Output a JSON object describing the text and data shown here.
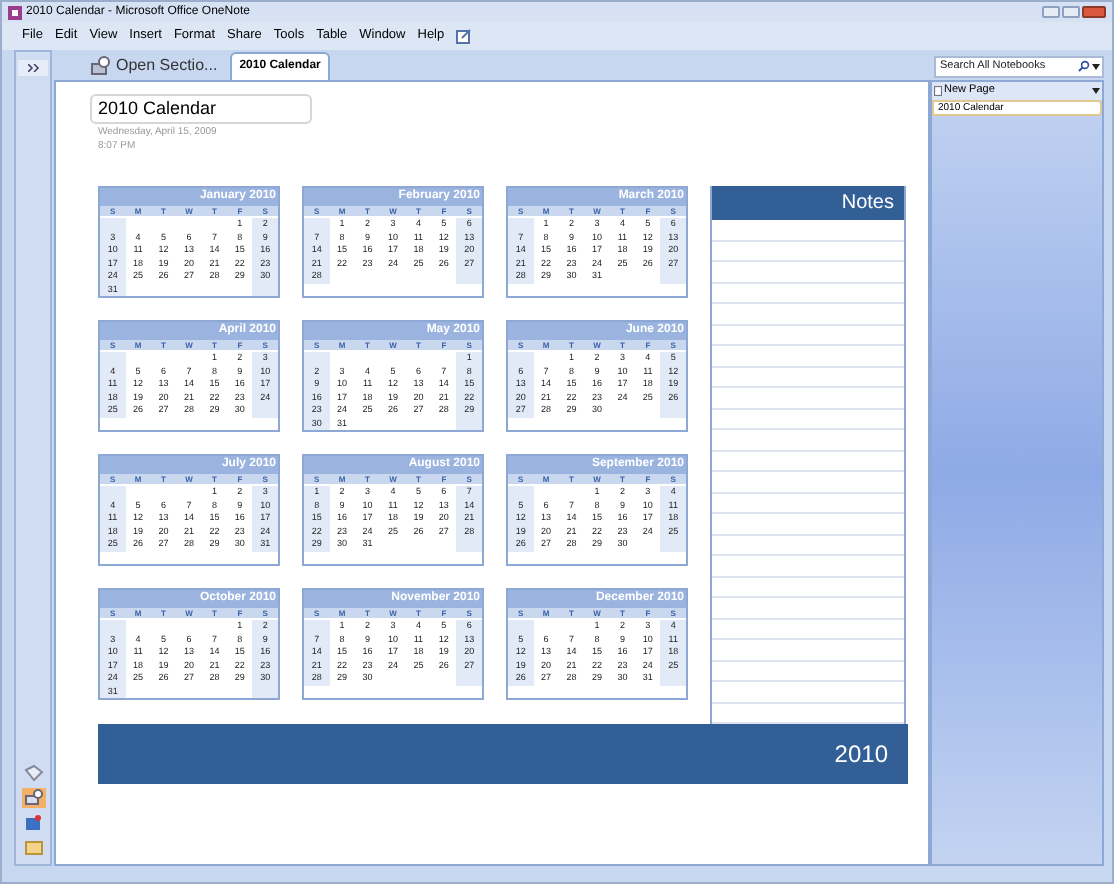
{
  "window": {
    "title": "2010 Calendar - Microsoft Office OneNote"
  },
  "menu": [
    "File",
    "Edit",
    "View",
    "Insert",
    "Format",
    "Share",
    "Tools",
    "Table",
    "Window",
    "Help"
  ],
  "tabs": [
    {
      "label": "Open Sectio...",
      "selected": false,
      "kind": "open"
    },
    {
      "label": "2010 Calendar",
      "selected": true,
      "kind": "section"
    }
  ],
  "search": {
    "placeholder": "Search All Notebooks"
  },
  "page": {
    "title": "2010 Calendar",
    "date": "Wednesday, April 15, 2009",
    "time": "8:07 PM"
  },
  "months": [
    {
      "title": "January 2010",
      "weekdays": [
        "S",
        "M",
        "T",
        "W",
        "T",
        "F",
        "S"
      ],
      "weeks": [
        [
          "1",
          "2"
        ],
        [
          "3",
          "4",
          "5",
          "6",
          "7",
          "8",
          "9"
        ],
        [
          "10",
          "11",
          "12",
          "13",
          "14",
          "15",
          "16"
        ],
        [
          "17",
          "18",
          "19",
          "20",
          "21",
          "22",
          "23"
        ],
        [
          "24",
          "25",
          "26",
          "27",
          "28",
          "29",
          "30"
        ],
        [
          "31"
        ]
      ]
    },
    {
      "title": "February 2010",
      "weekdays": [
        "S",
        "M",
        "T",
        "W",
        "T",
        "F",
        "S"
      ],
      "weeks": [
        [
          "1",
          "2",
          "3",
          "4",
          "5",
          "6"
        ],
        [
          "7",
          "8",
          "9",
          "10",
          "11",
          "12",
          "13"
        ],
        [
          "14",
          "15",
          "16",
          "17",
          "18",
          "19",
          "20"
        ],
        [
          "21",
          "22",
          "23",
          "24",
          "25",
          "26",
          "27"
        ],
        [
          "28"
        ]
      ]
    },
    {
      "title": "March 2010",
      "weekdays": [
        "S",
        "M",
        "T",
        "W",
        "T",
        "F",
        "S"
      ],
      "weeks": [
        [
          "1",
          "2",
          "3",
          "4",
          "5",
          "6"
        ],
        [
          "7",
          "8",
          "9",
          "10",
          "11",
          "12",
          "13"
        ],
        [
          "14",
          "15",
          "16",
          "17",
          "18",
          "19",
          "20"
        ],
        [
          "21",
          "22",
          "23",
          "24",
          "25",
          "26",
          "27"
        ],
        [
          "28",
          "29",
          "30",
          "31"
        ]
      ]
    },
    {
      "title": "April 2010",
      "weekdays": [
        "S",
        "M",
        "T",
        "W",
        "T",
        "F",
        "S"
      ],
      "weeks": [
        [
          "1",
          "2",
          "3"
        ],
        [
          "4",
          "5",
          "6",
          "7",
          "8",
          "9",
          "10"
        ],
        [
          "11",
          "12",
          "13",
          "14",
          "15",
          "16",
          "17"
        ],
        [
          "18",
          "19",
          "20",
          "21",
          "22",
          "23",
          "24"
        ],
        [
          "25",
          "26",
          "27",
          "28",
          "29",
          "30"
        ]
      ]
    },
    {
      "title": "May 2010",
      "weekdays": [
        "S",
        "M",
        "T",
        "W",
        "T",
        "F",
        "S"
      ],
      "weeks": [
        [
          "1"
        ],
        [
          "2",
          "3",
          "4",
          "5",
          "6",
          "7",
          "8"
        ],
        [
          "9",
          "10",
          "11",
          "12",
          "13",
          "14",
          "15"
        ],
        [
          "16",
          "17",
          "18",
          "19",
          "20",
          "21",
          "22"
        ],
        [
          "23",
          "24",
          "25",
          "26",
          "27",
          "28",
          "29"
        ],
        [
          "30",
          "31"
        ]
      ]
    },
    {
      "title": "June 2010",
      "weekdays": [
        "S",
        "M",
        "T",
        "W",
        "T",
        "F",
        "S"
      ],
      "weeks": [
        [
          "1",
          "2",
          "3",
          "4",
          "5"
        ],
        [
          "6",
          "7",
          "8",
          "9",
          "10",
          "11",
          "12"
        ],
        [
          "13",
          "14",
          "15",
          "16",
          "17",
          "18",
          "19"
        ],
        [
          "20",
          "21",
          "22",
          "23",
          "24",
          "25",
          "26"
        ],
        [
          "27",
          "28",
          "29",
          "30"
        ]
      ]
    },
    {
      "title": "July 2010",
      "weekdays": [
        "S",
        "M",
        "T",
        "W",
        "T",
        "F",
        "S"
      ],
      "weeks": [
        [
          "1",
          "2",
          "3"
        ],
        [
          "4",
          "5",
          "6",
          "7",
          "8",
          "9",
          "10"
        ],
        [
          "11",
          "12",
          "13",
          "14",
          "15",
          "16",
          "17"
        ],
        [
          "18",
          "19",
          "20",
          "21",
          "22",
          "23",
          "24"
        ],
        [
          "25",
          "26",
          "27",
          "28",
          "29",
          "30",
          "31"
        ]
      ]
    },
    {
      "title": "August 2010",
      "weekdays": [
        "S",
        "M",
        "T",
        "W",
        "T",
        "F",
        "S"
      ],
      "weeks": [
        [
          "1",
          "2",
          "3",
          "4",
          "5",
          "6",
          "7"
        ],
        [
          "8",
          "9",
          "10",
          "11",
          "12",
          "13",
          "14"
        ],
        [
          "15",
          "16",
          "17",
          "18",
          "19",
          "20",
          "21"
        ],
        [
          "22",
          "23",
          "24",
          "25",
          "26",
          "27",
          "28"
        ],
        [
          "29",
          "30",
          "31"
        ]
      ]
    },
    {
      "title": "September 2010",
      "weekdays": [
        "S",
        "M",
        "T",
        "W",
        "T",
        "F",
        "S"
      ],
      "weeks": [
        [
          "1",
          "2",
          "3",
          "4"
        ],
        [
          "5",
          "6",
          "7",
          "8",
          "9",
          "10",
          "11"
        ],
        [
          "12",
          "13",
          "14",
          "15",
          "16",
          "17",
          "18"
        ],
        [
          "19",
          "20",
          "21",
          "22",
          "23",
          "24",
          "25"
        ],
        [
          "26",
          "27",
          "28",
          "29",
          "30"
        ]
      ]
    },
    {
      "title": "October 2010",
      "weekdays": [
        "S",
        "M",
        "T",
        "W",
        "T",
        "F",
        "S"
      ],
      "weeks": [
        [
          "1",
          "2"
        ],
        [
          "3",
          "4",
          "5",
          "6",
          "7",
          "8",
          "9"
        ],
        [
          "10",
          "11",
          "12",
          "13",
          "14",
          "15",
          "16"
        ],
        [
          "17",
          "18",
          "19",
          "20",
          "21",
          "22",
          "23"
        ],
        [
          "24",
          "25",
          "26",
          "27",
          "28",
          "29",
          "30"
        ],
        [
          "31"
        ]
      ]
    },
    {
      "title": "November 2010",
      "weekdays": [
        "S",
        "M",
        "T",
        "W",
        "T",
        "F",
        "S"
      ],
      "weeks": [
        [
          "1",
          "2",
          "3",
          "4",
          "5",
          "6"
        ],
        [
          "7",
          "8",
          "9",
          "10",
          "11",
          "12",
          "13"
        ],
        [
          "14",
          "15",
          "16",
          "17",
          "18",
          "19",
          "20"
        ],
        [
          "21",
          "22",
          "23",
          "24",
          "25",
          "26",
          "27"
        ],
        [
          "28",
          "29",
          "30"
        ]
      ]
    },
    {
      "title": "December 2010",
      "weekdays": [
        "S",
        "M",
        "T",
        "W",
        "T",
        "F",
        "S"
      ],
      "weeks": [
        [
          "1",
          "2",
          "3",
          "4"
        ],
        [
          "5",
          "6",
          "7",
          "8",
          "9",
          "10",
          "11"
        ],
        [
          "12",
          "13",
          "14",
          "15",
          "16",
          "17",
          "18"
        ],
        [
          "19",
          "20",
          "21",
          "22",
          "23",
          "24",
          "25"
        ],
        [
          "26",
          "27",
          "28",
          "29",
          "30",
          "31"
        ]
      ]
    }
  ],
  "notes": {
    "title": "Notes"
  },
  "banner": {
    "year": "2010"
  },
  "pages_panel": {
    "new_page": "New Page",
    "pages": [
      {
        "label": "2010 Calendar",
        "selected": true
      }
    ]
  }
}
